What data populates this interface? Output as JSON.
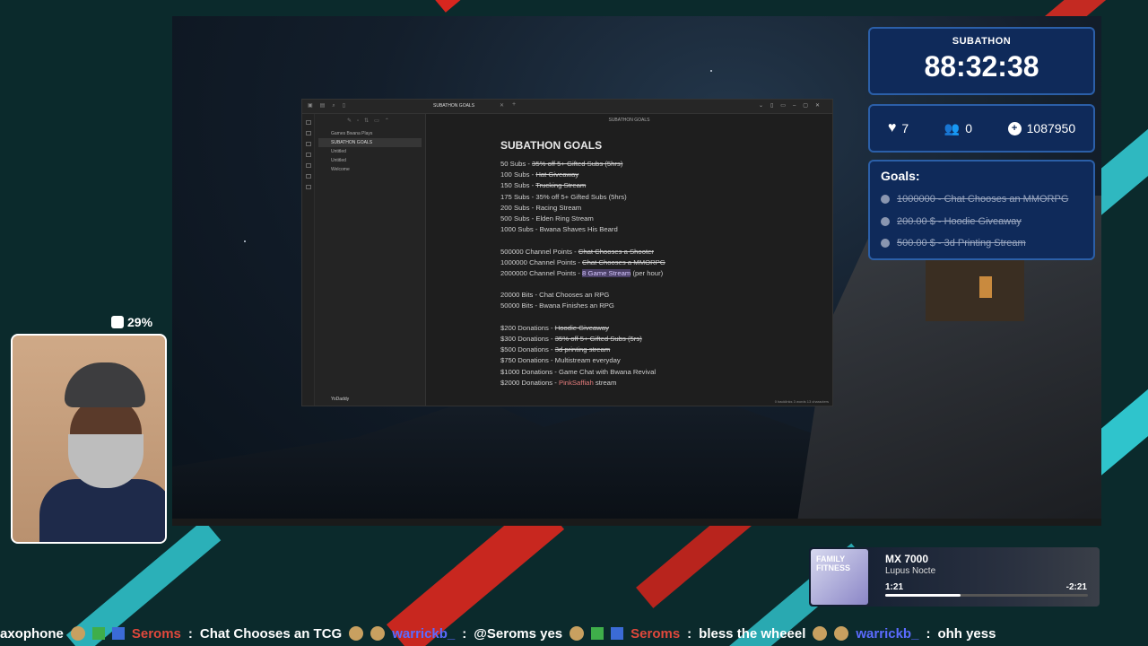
{
  "editor": {
    "tab_title": "SUBATHON GOALS",
    "header_title": "SUBATHON GOALS",
    "sidebar_files": [
      "Games Bwana Plays",
      "SUBATHON GOALS",
      "Untitled",
      "Untitled",
      "Welcome"
    ],
    "active_file_index": 1,
    "sidebar_user": "YoDaddy",
    "status_bar": "0 backlinks   3 words  13 characters",
    "doc_title": "SUBATHON GOALS",
    "lines": {
      "l1a": "50 Subs - ",
      "l1b": "35% off 5+ Gifted Subs (5hrs)",
      "l2a": "100 Subs - ",
      "l2b": "Hat Giveaway",
      "l3a": "150 Subs - ",
      "l3b": "Trucking Stream",
      "l4": "175 Subs - 35% off 5+ Gifted Subs (5hrs)",
      "l5": "200 Subs - Racing Stream",
      "l6": "500 Subs - Elden Ring Stream",
      "l7": "1000 Subs - Bwana Shaves His Beard",
      "l8a": "500000 Channel Points - ",
      "l8b": "Chat Chooses a Shooter",
      "l9a": "1000000 Channel Points - ",
      "l9b": "Chat Chooses a MMORPG",
      "l10a": "2000000 Channel Points - ",
      "l10b": "8 Game Stream",
      "l10c": " (per hour)",
      "l11": "20000 Bits - Chat Chooses an RPG",
      "l12": "50000 Bits - Bwana Finishes an RPG",
      "l13a": "$200 Donations - ",
      "l13b": "Hoodie Giveaway",
      "l14a": "$300 Donations - ",
      "l14b": "35% off 5+ Gifted Subs (5rs)",
      "l15a": "$500 Donations - ",
      "l15b": "3d printing stream",
      "l16": "$750 Donations - Multistream everyday",
      "l17": "$1000 Donations - Game Chat with Bwana Revival",
      "l18a": "$2000 Donations - ",
      "l18b": "PinkSaffiah",
      "l18c": " stream"
    }
  },
  "subathon": {
    "label": "SUBATHON",
    "timer": "88:32:38"
  },
  "stats": {
    "hearts": "7",
    "users": "0",
    "coins": "1087950"
  },
  "goals": {
    "title": "Goals:",
    "items": [
      {
        "text": "1000000 - Chat Chooses an MMORPG"
      },
      {
        "text": "200.00 $ - Hoodie Giveaway"
      },
      {
        "text": "500.00 $ - 3d Printing Stream"
      }
    ]
  },
  "cam": {
    "percent": "29%"
  },
  "now_playing": {
    "art_text": "FAMILY FITNESS",
    "title": "MX 7000",
    "artist": "Lupus Nocte",
    "elapsed": "1:21",
    "remaining": "-2:21",
    "progress": 0.37
  },
  "ticker": {
    "t1": "axophone",
    "u1": "Seroms",
    "m1": "Chat Chooses an TCG",
    "u2": "warrickb_",
    "m2": "@Seroms yes",
    "u3": "Seroms",
    "m3": "bless the wheeel",
    "u4": "warrickb_",
    "m4": "ohh yess"
  }
}
